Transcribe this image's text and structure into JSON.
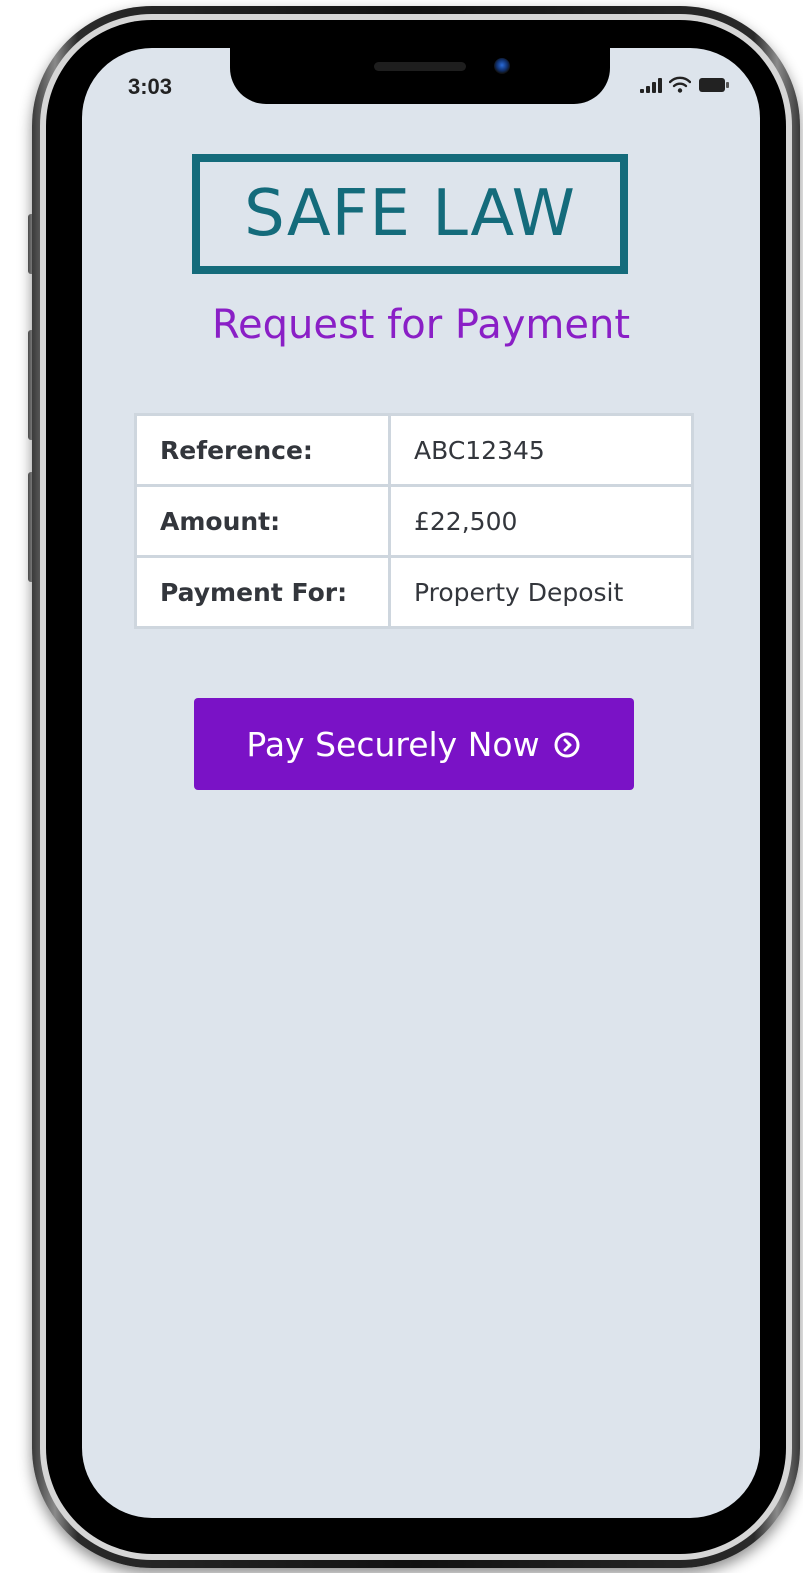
{
  "status_bar": {
    "time": "3:03",
    "icons": [
      "cellular-signal-icon",
      "wifi-icon",
      "battery-icon"
    ]
  },
  "logo": {
    "text": "SAFE LAW",
    "color": "#146b7b"
  },
  "page": {
    "title": "Request for Payment",
    "title_color": "#8a1fc6",
    "background": "#dde4ec"
  },
  "details": [
    {
      "label": "Reference:",
      "value": "ABC12345"
    },
    {
      "label": "Amount:",
      "value": "£22,500"
    },
    {
      "label": "Payment For:",
      "value": "Property Deposit"
    }
  ],
  "pay_button": {
    "label": "Pay Securely Now",
    "icon": "chevron-right-circle-icon",
    "color": "#7a12c6"
  }
}
